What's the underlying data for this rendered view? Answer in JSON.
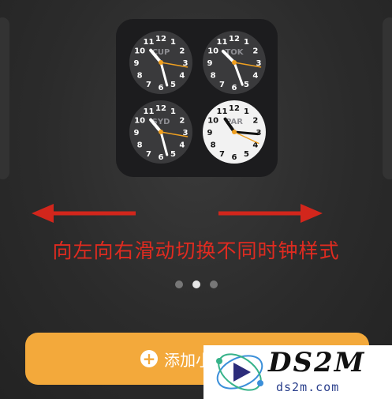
{
  "clocks": [
    {
      "city": "CUP",
      "face": "dark"
    },
    {
      "city": "TOK",
      "face": "dark"
    },
    {
      "city": "SYD",
      "face": "dark"
    },
    {
      "city": "PAR",
      "face": "light"
    }
  ],
  "caption": "向左向右滑动切换不同时钟样式",
  "pager": {
    "count": 3,
    "active_index": 1
  },
  "add_button": {
    "label": "添加小"
  },
  "watermark": {
    "main": "DS2M",
    "sub": "ds2m.com"
  },
  "colors": {
    "caption": "#e02b20",
    "button": "#f3a93b",
    "second_hand": "#f0a020",
    "background": "#2b2b2b"
  }
}
